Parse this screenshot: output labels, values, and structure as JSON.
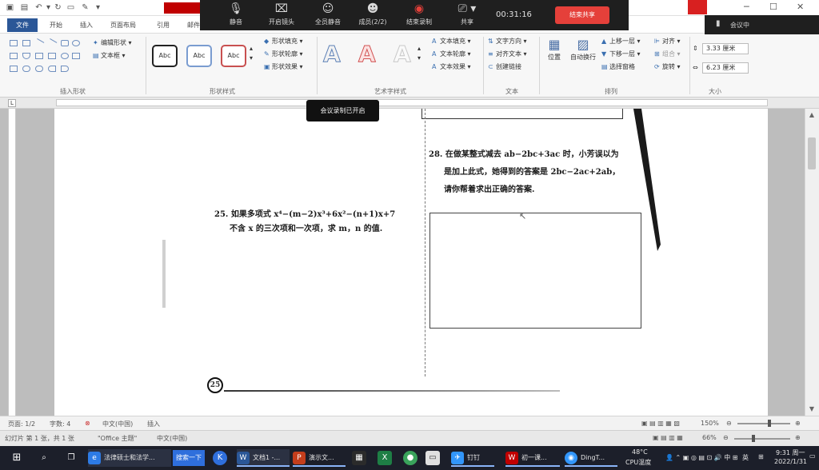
{
  "meeting": {
    "mute": "静音",
    "camera": "开启镜头",
    "mute_all": "全员静音",
    "members": "成员(2/2)",
    "stop_record": "结束录制",
    "share": "共享",
    "timer": "00:31:16",
    "end_share": "结束共享",
    "side_label": "会议中",
    "record_tooltip": "会议录制已开启"
  },
  "tabs": {
    "file": "文件",
    "home": "开始",
    "insert": "插入",
    "layout": "页面布局",
    "references": "引用",
    "mail": "邮件"
  },
  "ribbon": {
    "insert_shapes": {
      "label": "插入形状",
      "edit_shape": "编辑形状",
      "textbox": "文本框"
    },
    "shape_styles": {
      "label": "形状样式",
      "abc": "Abc",
      "fill": "形状填充",
      "outline": "形状轮廓",
      "effects": "形状效果"
    },
    "wordart": {
      "label": "艺术字样式",
      "letter": "A",
      "text_fill": "文本填充",
      "text_outline": "文本轮廓",
      "text_effects": "文本效果"
    },
    "text": {
      "label": "文本",
      "direction": "文字方向",
      "align": "对齐文本",
      "link": "创建链接"
    },
    "arrange": {
      "label": "排列",
      "position": "位置",
      "wrap": "自动换行",
      "bring_forward": "上移一层",
      "send_backward": "下移一层",
      "selection_pane": "选择窗格",
      "align": "对齐",
      "group": "组合",
      "rotate": "旋转"
    },
    "size": {
      "label": "大小",
      "height": "3.33 厘米",
      "width": "6.23 厘米"
    }
  },
  "document": {
    "q25_line1": "25. 如果多项式 x⁴−(m−2)x³+6x²−(n+1)x+7",
    "q25_line2": "不含 x 的三次项和一次项，求 m，n 的值.",
    "q28_line1": "28. 在做某整式减去 ab−2bc+3ac 时，小芳误以为",
    "q28_line2": "是加上此式，她得到的答案是 2bc−2ac+2ab，",
    "q28_line3": "请你帮着求出正确的答案.",
    "page_circle": "25"
  },
  "status_word": {
    "page": "页面: 1/2",
    "words": "字数: 4",
    "lang": "中文(中国)",
    "mode": "插入",
    "zoom": "150%"
  },
  "status_ppt": {
    "slide": "幻灯片 第 1 张，共 1 张",
    "theme": "\"Office 主题\"",
    "lang": "中文(中国)",
    "zoom": "66%"
  },
  "taskbar": {
    "browser_tab": "法律硕士和法学...",
    "search_btn": "搜索一下",
    "word_doc": "文档1 -...",
    "ppt_doc": "演示文...",
    "dingding": "钉钉",
    "course": "初一课...",
    "dingtalk": "DingT...",
    "temp": "48°C",
    "cpu": "CPU温度",
    "ime": "英",
    "time": "9:31 周一",
    "date": "2022/1/31"
  }
}
